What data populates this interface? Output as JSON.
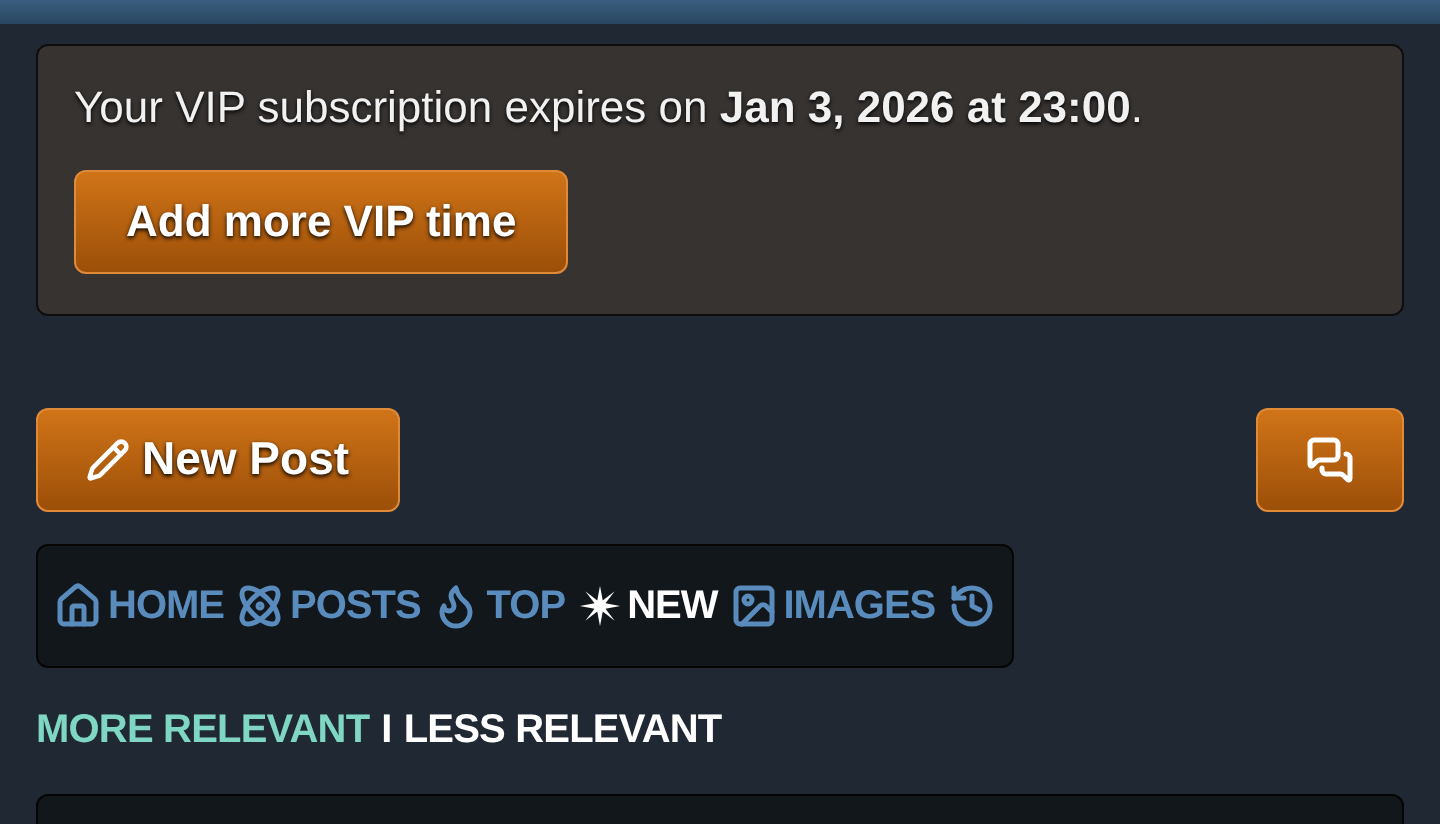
{
  "vip_notice": {
    "text": "Your VIP subscription expires on **Jan 3, 2026 at 23:00**.",
    "button": "Add more VIP time"
  },
  "actions": {
    "new_post": "New Post"
  },
  "nav_tabs": [
    {
      "kind": "home",
      "label": "HOME",
      "selected": false
    },
    {
      "kind": "posts",
      "label": "POSTS",
      "selected": false
    },
    {
      "kind": "top",
      "label": "TOP",
      "selected": false
    },
    {
      "kind": "new",
      "label": "NEW",
      "selected": true
    },
    {
      "kind": "images",
      "label": "IMAGES",
      "selected": false
    },
    {
      "kind": "history",
      "selected": false
    }
  ],
  "relevance": [
    {
      "label": "MORE RELEVANT",
      "selected": false
    },
    {
      "label": "LESS RELEVANT",
      "selected": true
    }
  ],
  "relevance_separator": "I"
}
